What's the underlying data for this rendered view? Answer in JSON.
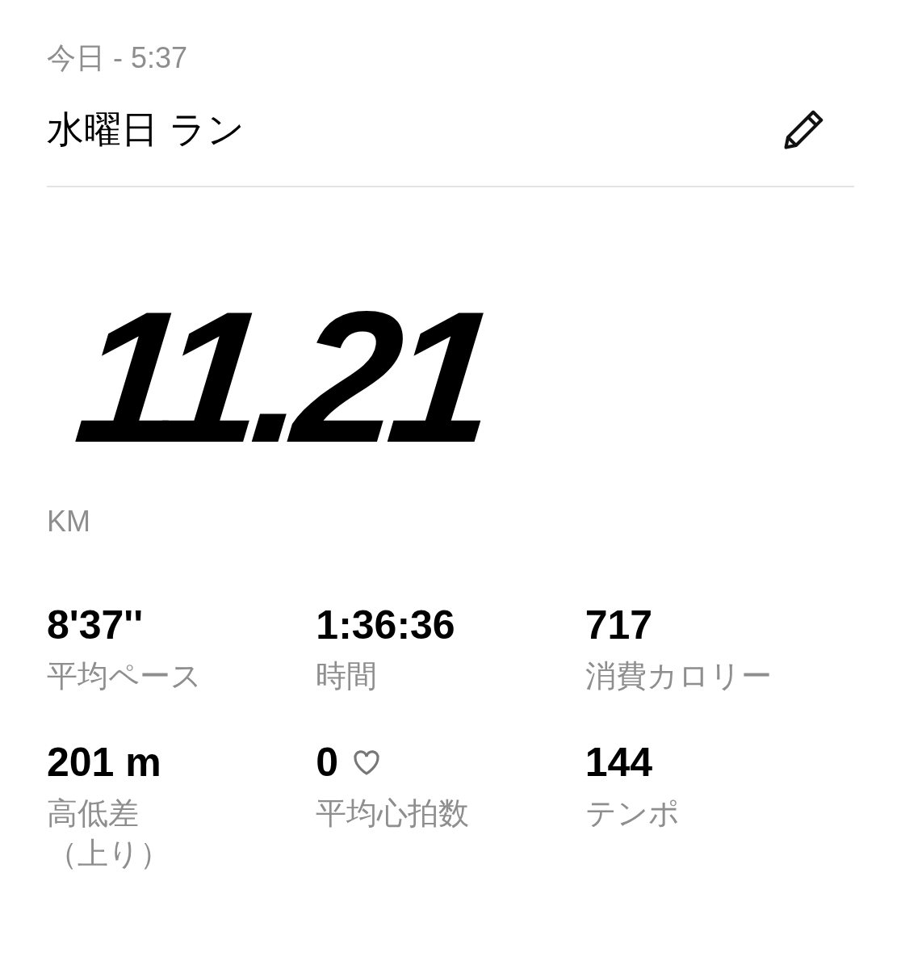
{
  "header": {
    "date": "今日 - 5:37",
    "title": "水曜日 ラン"
  },
  "distance": {
    "value": "11.21",
    "unit": "KM"
  },
  "stats": [
    {
      "value": "8'37''",
      "label": [
        "平均ペース"
      ],
      "heart": false
    },
    {
      "value": "1:36:36",
      "label": [
        "時間"
      ],
      "heart": false
    },
    {
      "value": "717",
      "label": [
        "消費カロリー"
      ],
      "heart": false
    },
    {
      "value": "201 m",
      "label": [
        "高低差",
        "（上り）"
      ],
      "heart": false
    },
    {
      "value": "0",
      "label": [
        "平均心拍数"
      ],
      "heart": true
    },
    {
      "value": "144",
      "label": [
        "テンポ"
      ],
      "heart": false
    }
  ]
}
